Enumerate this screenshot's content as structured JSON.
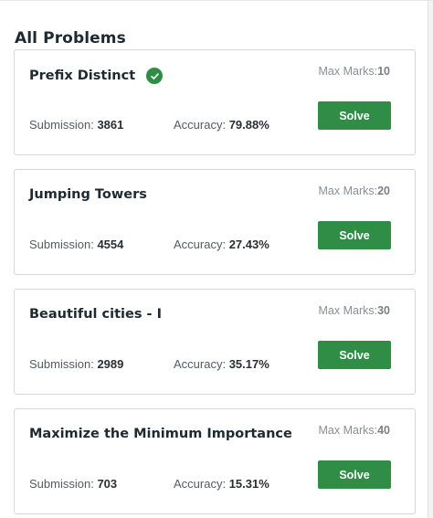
{
  "heading": "All Problems",
  "problems": [
    {
      "title": "Prefix Distinct",
      "solved": true,
      "max_marks_label": "Max Marks:",
      "max_marks": "10",
      "submission_label": "Submission:",
      "submission": "3861",
      "accuracy_label": "Accuracy:",
      "accuracy": "79.88%",
      "button": "Solve"
    },
    {
      "title": "Jumping Towers",
      "solved": false,
      "max_marks_label": "Max Marks:",
      "max_marks": "20",
      "submission_label": "Submission:",
      "submission": "4554",
      "accuracy_label": "Accuracy:",
      "accuracy": "27.43%",
      "button": "Solve"
    },
    {
      "title": "Beautiful cities - I",
      "solved": false,
      "max_marks_label": "Max Marks:",
      "max_marks": "30",
      "submission_label": "Submission:",
      "submission": "2989",
      "accuracy_label": "Accuracy:",
      "accuracy": "35.17%",
      "button": "Solve"
    },
    {
      "title": "Maximize the Minimum Importance",
      "solved": false,
      "max_marks_label": "Max Marks:",
      "max_marks": "40",
      "submission_label": "Submission:",
      "submission": "703",
      "accuracy_label": "Accuracy:",
      "accuracy": "15.31%",
      "button": "Solve"
    }
  ],
  "colors": {
    "accent": "#2f8d46",
    "text": "#1e2a32",
    "muted": "#8a8f95",
    "border": "#d6d6d6"
  },
  "icons": {
    "solved": "check-circle-icon"
  }
}
